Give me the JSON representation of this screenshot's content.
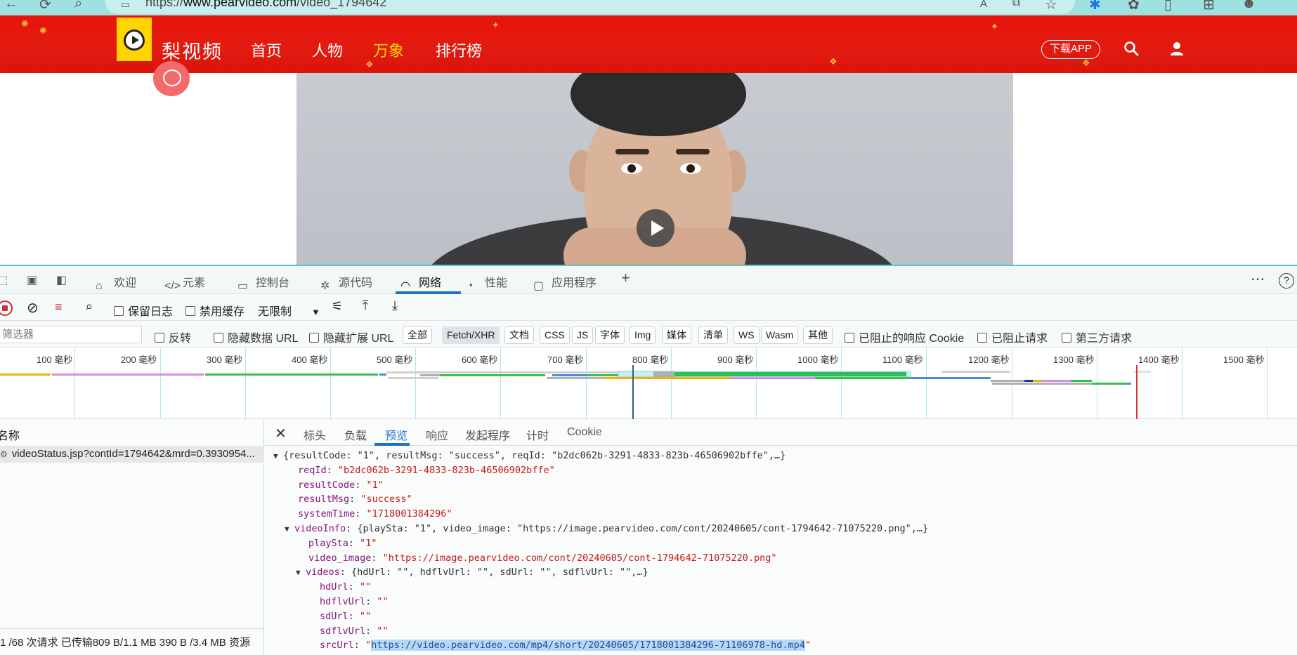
{
  "browser": {
    "url_prefix": "https://",
    "url_host": "www.pearvideo.com",
    "url_path": "/video_1794642"
  },
  "site": {
    "logo_text": "梨视频",
    "nav": [
      "首页",
      "人物",
      "万象",
      "排行榜"
    ],
    "active_nav": "万象",
    "download_label": "下载APP"
  },
  "devtools": {
    "tabs": [
      "欢迎",
      "元素",
      "控制台",
      "源代码",
      "网络",
      "性能",
      "应用程序"
    ],
    "active_tab": "网络",
    "toolbar": {
      "preserve_log": "保留日志",
      "disable_cache": "禁用缓存",
      "throttle": "无限制"
    },
    "filter": {
      "placeholder": "筛选器",
      "invert": "反转",
      "hide_data_url": "隐藏数据 URL",
      "hide_ext_url": "隐藏扩展 URL",
      "types": [
        "全部",
        "Fetch/XHR",
        "文档",
        "CSS",
        "JS",
        "字体",
        "Img",
        "媒体",
        "清单",
        "WS",
        "Wasm",
        "其他"
      ],
      "active_type": "Fetch/XHR",
      "blocked_cookies": "已阻止的响应 Cookie",
      "blocked_requests": "已阻止请求",
      "third_party": "第三方请求"
    },
    "timeline_ticks": [
      "100 毫秒",
      "200 毫秒",
      "300 毫秒",
      "400 毫秒",
      "500 毫秒",
      "600 毫秒",
      "700 毫秒",
      "800 毫秒",
      "900 毫秒",
      "1000 毫秒",
      "1100 毫秒",
      "1200 毫秒",
      "1300 毫秒",
      "1400 毫秒",
      "1500 毫秒"
    ],
    "name_header": "名称",
    "request_name": "videoStatus.jsp?contId=1794642&mrd=0.3930954...",
    "status": "1 /68 次请求  已传输809 B/1.1 MB  390 B /3.4 MB 资源",
    "detail_tabs": [
      "标头",
      "负载",
      "预览",
      "响应",
      "发起程序",
      "计时",
      "Cookie"
    ],
    "active_detail_tab": "预览",
    "preview": {
      "summary": "{resultCode: \"1\", resultMsg: \"success\", reqId: \"b2dc062b-3291-4833-823b-46506902bffe\",…}",
      "reqId": "\"b2dc062b-3291-4833-823b-46506902bffe\"",
      "resultCode": "\"1\"",
      "resultMsg": "\"success\"",
      "systemTime": "\"1718001384296\"",
      "videoInfo_summary": "{playSta: \"1\", video_image: \"https://image.pearvideo.com/cont/20240605/cont-1794642-71075220.png\",…}",
      "playSta": "\"1\"",
      "video_image": "\"https://image.pearvideo.com/cont/20240605/cont-1794642-71075220.png\"",
      "videos_summary": "{hdUrl: \"\", hdflvUrl: \"\", sdUrl: \"\", sdflvUrl: \"\",…}",
      "hdUrl": "\"\"",
      "hdflvUrl": "\"\"",
      "sdUrl": "\"\"",
      "sdflvUrl": "\"\"",
      "srcUrl": "https://video.pearvideo.com/mp4/short/20240605/1718001384296-71106978-hd.mp4"
    }
  },
  "colors": {
    "header_red": "#e8140c",
    "accent_yellow": "#ffd400",
    "devtools_blue": "#1a73c8"
  }
}
